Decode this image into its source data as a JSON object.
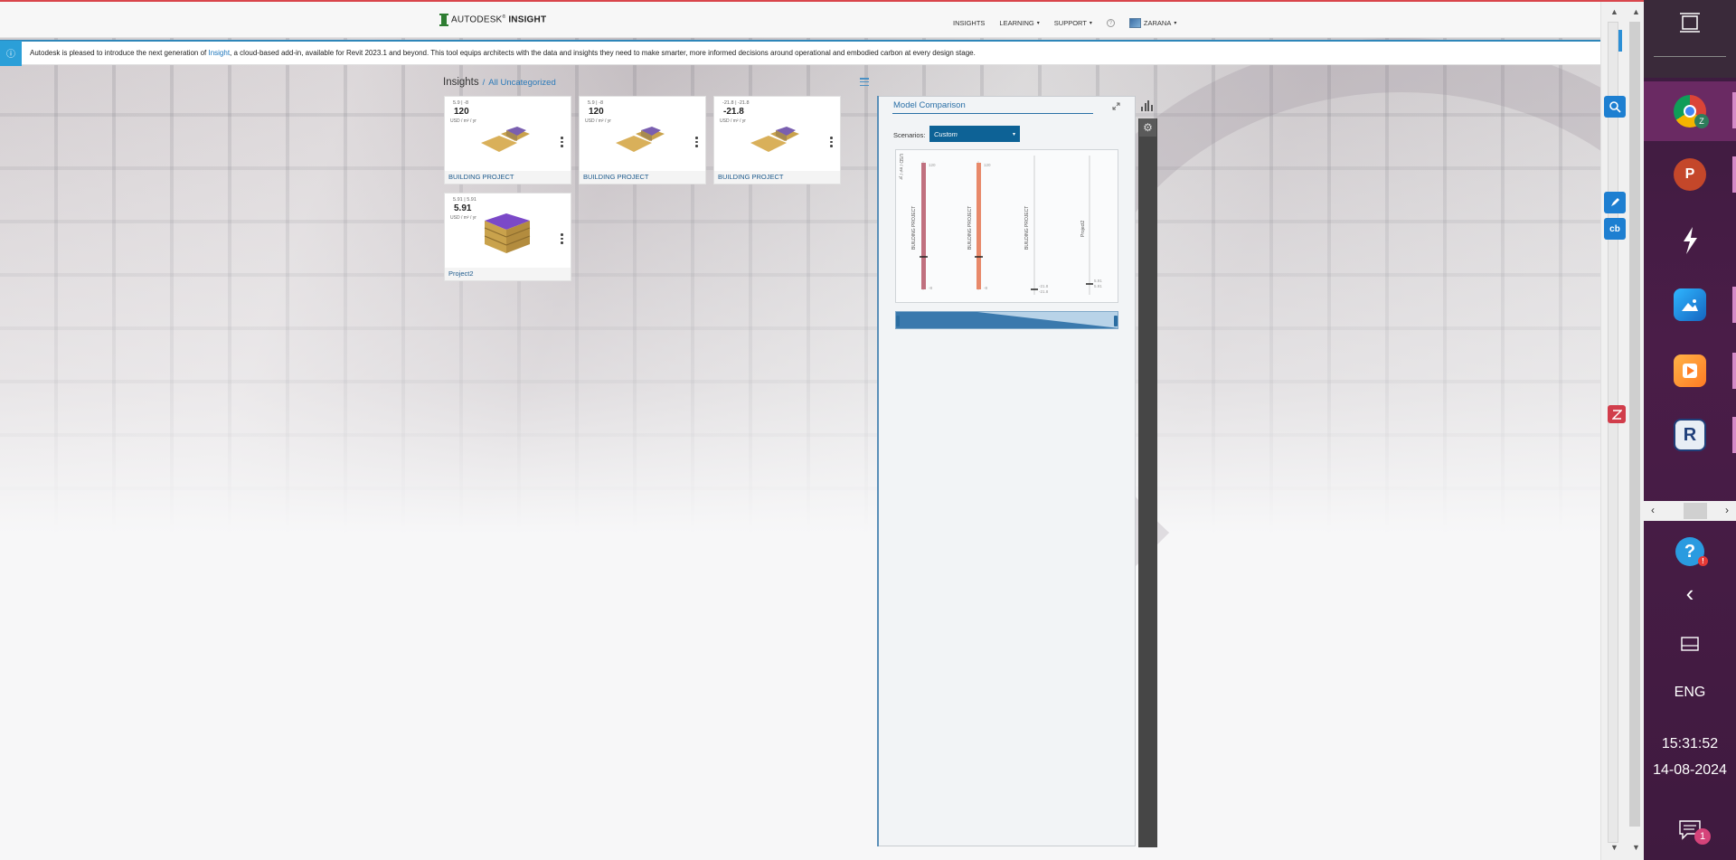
{
  "app": {
    "brand_prefix": "AUTODESK",
    "brand_suffix": "INSIGHT"
  },
  "nav": {
    "insights": "INSIGHTS",
    "learning": "LEARNING",
    "support": "SUPPORT",
    "user": "ZARANA"
  },
  "banner": {
    "text_before": "Autodesk is pleased to introduce the next generation of ",
    "link": "Insight",
    "text_after": ", a cloud-based add-in, available for Revit 2023.1 and beyond. This tool equips architects with the data and insights they need to make smarter, more informed decisions around operational and embodied carbon at every design stage."
  },
  "insights": {
    "title": "Insights",
    "separator": "/",
    "category": "All Uncategorized"
  },
  "cards": [
    {
      "range": "5.9 | -8",
      "value": "120",
      "unit": "USD / m² / yr",
      "name": "BUILDING PROJECT"
    },
    {
      "range": "5.9 | -8",
      "value": "120",
      "unit": "USD / m² / yr",
      "name": "BUILDING PROJECT"
    },
    {
      "range": "-21.8 | -21.8",
      "value": "-21.8",
      "unit": "USD / m² / yr",
      "name": "BUILDING PROJECT"
    },
    {
      "range": "5.91 | 5.91",
      "value": "5.91",
      "unit": "USD / m² / yr",
      "name": "Project2"
    }
  ],
  "comparison": {
    "title": "Model Comparison",
    "scenarios_label": "Scenarios:",
    "scenario_value": "Custom",
    "y_unit": "USD / m² / yr",
    "bars": [
      {
        "label": "BUILDING PROJECT",
        "top_label": "120",
        "bottom_label": "-8",
        "color": "#c0707f"
      },
      {
        "label": "BUILDING PROJECT",
        "top_label": "120",
        "bottom_label": "-8",
        "color": "#e8896a"
      },
      {
        "label": "BUILDING PROJECT",
        "top_label": "-21.8",
        "bottom_label": "-21.8",
        "color": "#444444"
      },
      {
        "label": "Project2",
        "top_label": "5.91",
        "bottom_label": "5.91",
        "color": "#444444"
      }
    ]
  },
  "taskbar": {
    "language": "ENG",
    "time": "15:31:52",
    "date": "14-08-2024",
    "notification_count": "1",
    "chrome_badge": "Z",
    "powerpoint": "P",
    "revit": "R"
  },
  "extensions": {
    "cb": "cb"
  }
}
